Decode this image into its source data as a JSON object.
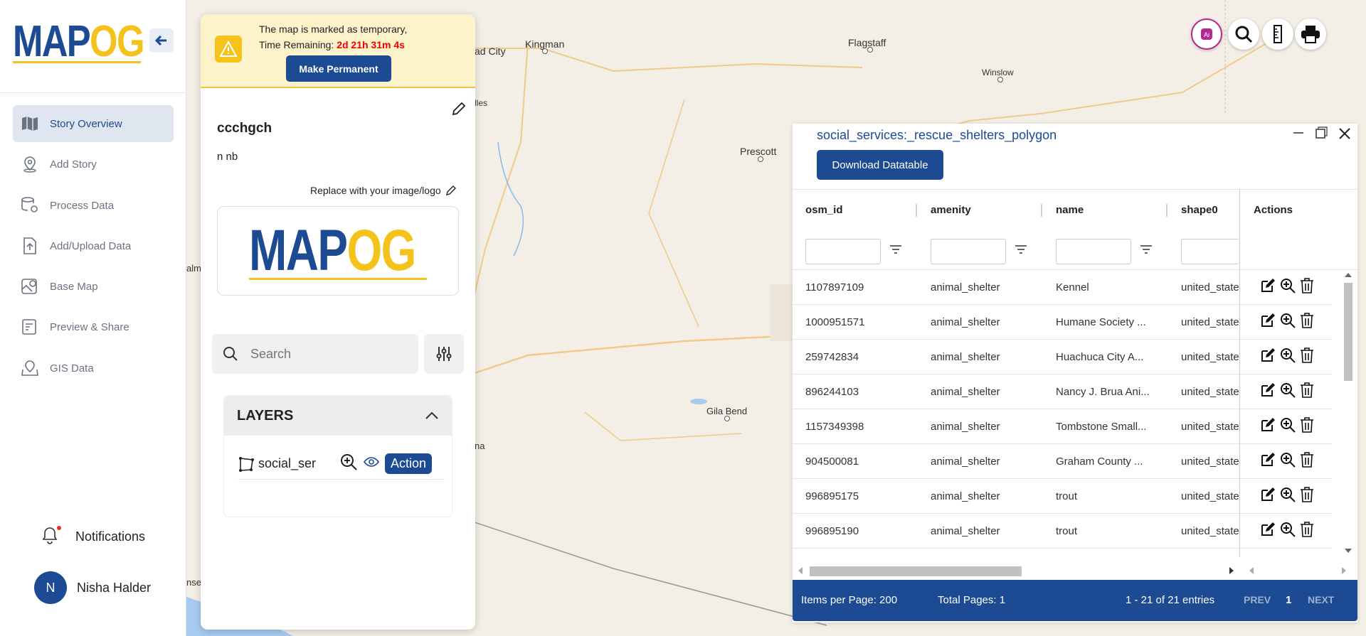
{
  "sidebar": {
    "logo": {
      "map": "MAP",
      "og": "OG"
    },
    "items": [
      {
        "label": "Story Overview",
        "icon": "map-icon",
        "active": true
      },
      {
        "label": "Add Story",
        "icon": "location-pin-icon"
      },
      {
        "label": "Process Data",
        "icon": "data-gear-icon"
      },
      {
        "label": "Add/Upload Data",
        "icon": "upload-file-icon"
      },
      {
        "label": "Base Map",
        "icon": "base-map-icon"
      },
      {
        "label": "Preview & Share",
        "icon": "preview-share-icon"
      },
      {
        "label": "GIS Data",
        "icon": "gis-data-icon"
      }
    ],
    "notifications_label": "Notifications",
    "user": {
      "initial": "N",
      "name": "Nisha Halder"
    }
  },
  "map": {
    "labels": [
      "Kingman",
      "Flagstaff",
      "Winslow",
      "Prescott",
      "Gila Bend",
      "ad City",
      "lles",
      "alm",
      "nse",
      "na"
    ]
  },
  "story": {
    "banner_line1": "The map is marked as temporary,",
    "banner_line2_prefix": "Time Remaining: ",
    "time_remaining": "2d 21h 31m 4s",
    "make_permanent_label": "Make Permanent",
    "title": "ccchgch",
    "description": "n nb",
    "replace_logo_label": "Replace with your image/logo",
    "search_placeholder": "Search",
    "layers_title": "LAYERS",
    "layer": {
      "name": "social_ser",
      "action_label": "Action"
    }
  },
  "table": {
    "title": "social_services:_rescue_shelters_polygon",
    "download_label": "Download Datatable",
    "columns": [
      "osm_id",
      "amenity",
      "name",
      "shape0",
      "Actions"
    ],
    "rows": [
      [
        "1107897109",
        "animal_shelter",
        "Kennel",
        "united_state"
      ],
      [
        "1000951571",
        "animal_shelter",
        "Humane Society ...",
        "united_state"
      ],
      [
        "259742834",
        "animal_shelter",
        "Huachuca City A...",
        "united_state"
      ],
      [
        "896244103",
        "animal_shelter",
        "Nancy J. Brua Ani...",
        "united_state"
      ],
      [
        "1157349398",
        "animal_shelter",
        "Tombstone Small...",
        "united_state"
      ],
      [
        "904500081",
        "animal_shelter",
        "Graham County ...",
        "united_state"
      ],
      [
        "996895175",
        "animal_shelter",
        "trout",
        "united_state"
      ],
      [
        "996895190",
        "animal_shelter",
        "trout",
        "united_state"
      ]
    ],
    "footer": {
      "items_per_page": "Items per Page: 200",
      "total_pages": "Total Pages: 1",
      "entries": "1 - 21 of 21 entries",
      "prev": "PREV",
      "page": "1",
      "next": "NEXT"
    }
  },
  "colors": {
    "brand": "#1c4a93",
    "accent": "#f5c21b",
    "warning": "#e00000"
  }
}
